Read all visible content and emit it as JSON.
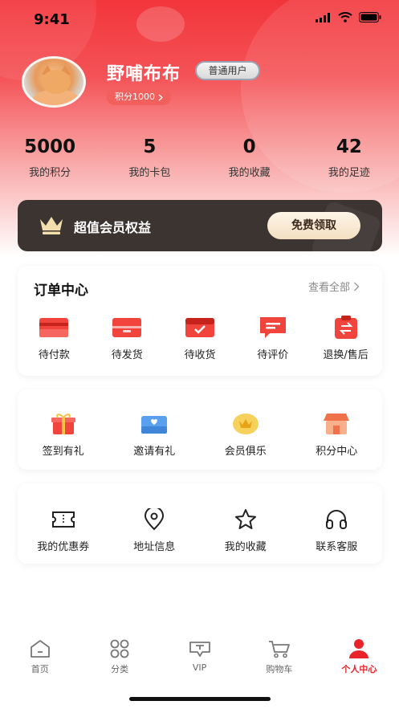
{
  "status_bar": {
    "time": "9:41"
  },
  "profile": {
    "username": "野哺布布",
    "badge": "普通用户",
    "points_label": "积分1000"
  },
  "stats": [
    {
      "value": "5000",
      "label": "我的积分"
    },
    {
      "value": "5",
      "label": "我的卡包"
    },
    {
      "value": "0",
      "label": "我的收藏"
    },
    {
      "value": "42",
      "label": "我的足迹"
    }
  ],
  "vip_banner": {
    "text": "超值会员权益",
    "button": "免费领取"
  },
  "orders": {
    "title": "订单中心",
    "more": "查看全部",
    "items": [
      {
        "label": "待付款",
        "icon": "wallet-icon"
      },
      {
        "label": "待发货",
        "icon": "package-icon"
      },
      {
        "label": "待收货",
        "icon": "box-check-icon"
      },
      {
        "label": "待评价",
        "icon": "comment-icon"
      },
      {
        "label": "退换/售后",
        "icon": "return-icon"
      }
    ]
  },
  "services": {
    "items": [
      {
        "label": "签到有礼",
        "icon": "gift-icon"
      },
      {
        "label": "邀请有礼",
        "icon": "invite-icon"
      },
      {
        "label": "会员俱乐",
        "icon": "crown-icon"
      },
      {
        "label": "积分中心",
        "icon": "shop-icon"
      }
    ]
  },
  "tools": {
    "items": [
      {
        "label": "我的优惠券",
        "icon": "ticket-icon"
      },
      {
        "label": "地址信息",
        "icon": "location-icon"
      },
      {
        "label": "我的收藏",
        "icon": "star-icon"
      },
      {
        "label": "联系客服",
        "icon": "headset-icon"
      }
    ]
  },
  "tabbar": [
    {
      "label": "首页",
      "icon": "home-icon",
      "active": false
    },
    {
      "label": "分类",
      "icon": "grid-icon",
      "active": false
    },
    {
      "label": "VIP",
      "icon": "vip-icon",
      "active": false
    },
    {
      "label": "购物车",
      "icon": "cart-icon",
      "active": false
    },
    {
      "label": "个人中心",
      "icon": "person-icon",
      "active": true
    }
  ],
  "colors": {
    "primary": "#e8242a",
    "vip_dark": "#3b3431",
    "gold": "#f3dfc2"
  }
}
